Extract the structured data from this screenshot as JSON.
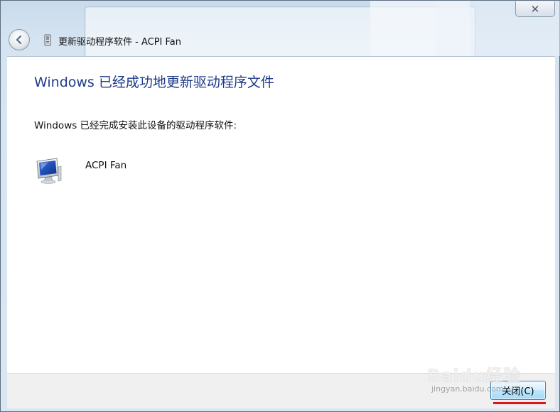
{
  "window": {
    "title": "更新驱动程序软件 - ACPI Fan",
    "close_glyph": "✕"
  },
  "content": {
    "heading": "Windows 已经成功地更新驱动程序文件",
    "message": "Windows 已经完成安装此设备的驱动程序软件:",
    "device_name": "ACPI Fan",
    "device_icon": "monitor-device-icon"
  },
  "footer": {
    "close_label": "关闭(C)"
  },
  "watermark": {
    "brand": "Baidu经验",
    "url": "jingyan.baidu.com"
  },
  "colors": {
    "heading": "#1e3a8a",
    "accent_underline": "#e0141e"
  }
}
